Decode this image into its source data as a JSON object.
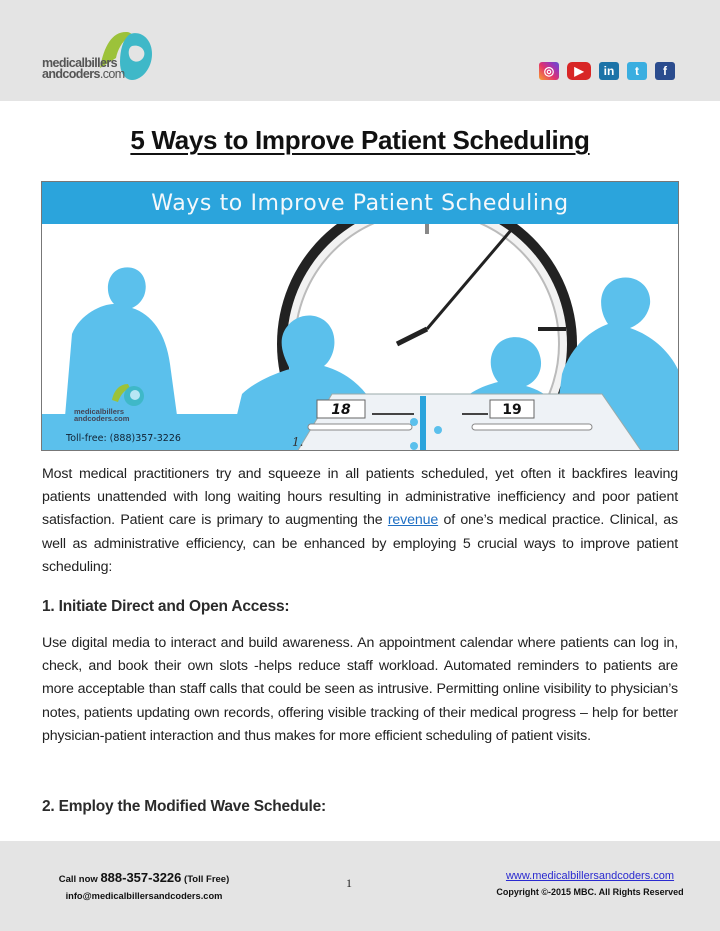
{
  "header": {
    "logo": {
      "line1": "medicalbillers",
      "line2": "andcoders",
      "suffix": ".com"
    },
    "social": [
      {
        "name": "instagram",
        "glyph": "◎"
      },
      {
        "name": "youtube",
        "glyph": "▶"
      },
      {
        "name": "linkedin",
        "glyph": "in"
      },
      {
        "name": "twitter",
        "glyph": "t"
      },
      {
        "name": "facebook",
        "glyph": "f"
      }
    ]
  },
  "document": {
    "title": "5 Ways to Improve Patient Scheduling",
    "hero": {
      "banner": "Ways to Improve Patient Scheduling",
      "logo_line1": "medicalbillers",
      "logo_line2": "andcoders.com",
      "tollfree": "Toll-free: (888)357-3226",
      "calendar_left": "18",
      "calendar_right": "19",
      "calendar_note": "1."
    },
    "intro": {
      "before_link": "Most medical practitioners try and squeeze in all patients scheduled, yet often it backfires leaving patients unattended with long waiting hours resulting in administrative inefficiency and poor patient satisfaction. Patient care is primary to augmenting the ",
      "link": "revenue",
      "after_link": " of one’s medical practice. Clinical, as well as administrative efficiency, can be enhanced by employing 5 crucial ways to improve patient scheduling:"
    },
    "sections": [
      {
        "heading": "1. Initiate Direct and Open Access:",
        "body": "Use digital media to interact and build awareness. An appointment calendar where patients can log in, check, and book their own slots -helps reduce staff workload. Automated reminders to patients are more acceptable than staff calls that could be seen as intrusive. Permitting online visibility to physician’s notes, patients updating own records, offering visible tracking of their medical progress – help for better physician-patient interaction and thus makes for more efficient scheduling of patient visits."
      },
      {
        "heading": "2. Employ the Modified Wave Schedule:"
      }
    ]
  },
  "footer": {
    "call_prefix": "Call now ",
    "phone": "888-357-3226",
    "call_suffix": " (Toll Free)",
    "email": "info@medicalbillersandcoders.com",
    "page_number": "1",
    "website": "www.medicalbillersandcoders.com",
    "copyright": "Copyright ©-2015 MBC. All Rights Reserved"
  },
  "colors": {
    "band": "#e4e4e4",
    "hero_blue": "#2ba4dc",
    "silhouette": "#5bc0ec",
    "link": "#1f6fc3",
    "logo_green": "#9cc23a",
    "logo_teal": "#3fb8c8"
  }
}
